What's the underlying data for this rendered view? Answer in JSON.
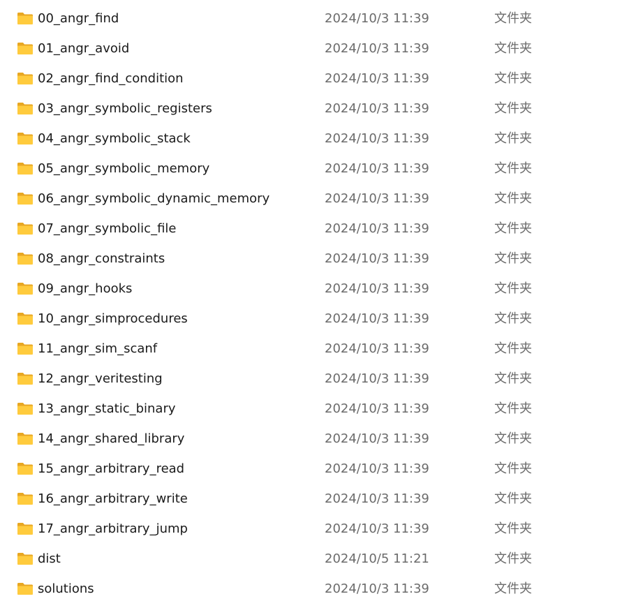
{
  "icons": {
    "folder": "folder-icon"
  },
  "colors": {
    "folder_back": "#E8A723",
    "folder_front": "#FFCB3D",
    "name_text": "#1a1a1a",
    "meta_text": "#6b6b6b"
  },
  "files": [
    {
      "name": "00_angr_find",
      "date": "2024/10/3 11:39",
      "type": "文件夹"
    },
    {
      "name": "01_angr_avoid",
      "date": "2024/10/3 11:39",
      "type": "文件夹"
    },
    {
      "name": "02_angr_find_condition",
      "date": "2024/10/3 11:39",
      "type": "文件夹"
    },
    {
      "name": "03_angr_symbolic_registers",
      "date": "2024/10/3 11:39",
      "type": "文件夹"
    },
    {
      "name": "04_angr_symbolic_stack",
      "date": "2024/10/3 11:39",
      "type": "文件夹"
    },
    {
      "name": "05_angr_symbolic_memory",
      "date": "2024/10/3 11:39",
      "type": "文件夹"
    },
    {
      "name": "06_angr_symbolic_dynamic_memory",
      "date": "2024/10/3 11:39",
      "type": "文件夹"
    },
    {
      "name": "07_angr_symbolic_file",
      "date": "2024/10/3 11:39",
      "type": "文件夹"
    },
    {
      "name": "08_angr_constraints",
      "date": "2024/10/3 11:39",
      "type": "文件夹"
    },
    {
      "name": "09_angr_hooks",
      "date": "2024/10/3 11:39",
      "type": "文件夹"
    },
    {
      "name": "10_angr_simprocedures",
      "date": "2024/10/3 11:39",
      "type": "文件夹"
    },
    {
      "name": "11_angr_sim_scanf",
      "date": "2024/10/3 11:39",
      "type": "文件夹"
    },
    {
      "name": "12_angr_veritesting",
      "date": "2024/10/3 11:39",
      "type": "文件夹"
    },
    {
      "name": "13_angr_static_binary",
      "date": "2024/10/3 11:39",
      "type": "文件夹"
    },
    {
      "name": "14_angr_shared_library",
      "date": "2024/10/3 11:39",
      "type": "文件夹"
    },
    {
      "name": "15_angr_arbitrary_read",
      "date": "2024/10/3 11:39",
      "type": "文件夹"
    },
    {
      "name": "16_angr_arbitrary_write",
      "date": "2024/10/3 11:39",
      "type": "文件夹"
    },
    {
      "name": "17_angr_arbitrary_jump",
      "date": "2024/10/3 11:39",
      "type": "文件夹"
    },
    {
      "name": "dist",
      "date": "2024/10/5 11:21",
      "type": "文件夹"
    },
    {
      "name": "solutions",
      "date": "2024/10/3 11:39",
      "type": "文件夹"
    }
  ]
}
